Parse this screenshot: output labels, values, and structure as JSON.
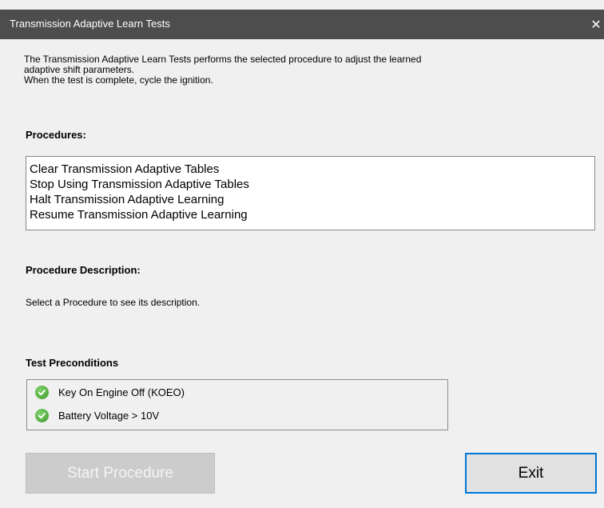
{
  "window": {
    "title": "Transmission Adaptive Learn Tests",
    "close_glyph": "✕"
  },
  "intro": {
    "line1": "The Transmission Adaptive Learn Tests performs the selected procedure to adjust the learned",
    "line2": "adaptive shift parameters.",
    "line3": "When the test is complete, cycle the ignition."
  },
  "procedures": {
    "label": "Procedures:",
    "items": [
      "Clear Transmission Adaptive Tables",
      "Stop Using Transmission Adaptive Tables",
      "Halt Transmission Adaptive Learning",
      "Resume Transmission Adaptive Learning"
    ]
  },
  "description": {
    "label": "Procedure Description:",
    "text": "Select a Procedure to see its description."
  },
  "preconditions": {
    "label": "Test Preconditions",
    "items": [
      {
        "text": "Key On Engine Off (KOEO)",
        "icon": "check-circle-icon",
        "status": "passed"
      },
      {
        "text": "Battery Voltage > 10V",
        "icon": "check-circle-icon",
        "status": "passed"
      }
    ]
  },
  "buttons": {
    "start_label": "Start Procedure",
    "start_enabled": false,
    "exit_label": "Exit"
  },
  "colors": {
    "titlebar": "#4d4d4d",
    "accent_focus": "#0078d7",
    "check_green": "#4caf36"
  }
}
